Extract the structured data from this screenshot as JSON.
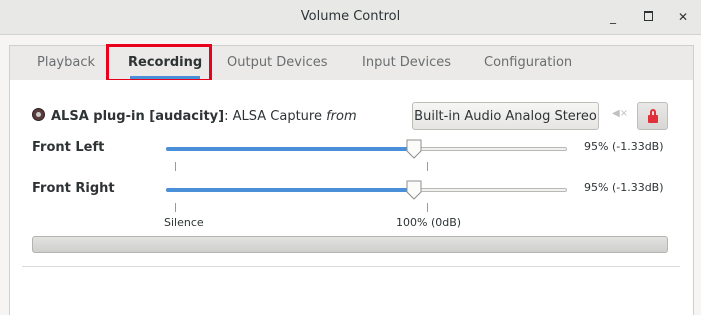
{
  "window": {
    "title": "Volume Control",
    "minimize_label": "_",
    "maximize_label": "◻",
    "close_label": "✕"
  },
  "tabs": [
    {
      "label": "Playback",
      "active": false
    },
    {
      "label": "Recording",
      "active": true
    },
    {
      "label": "Output Devices",
      "active": false
    },
    {
      "label": "Input Devices",
      "active": false
    },
    {
      "label": "Configuration",
      "active": false
    }
  ],
  "stream": {
    "app_icon": "audacity-icon",
    "name": "ALSA plug-in [audacity]",
    "separator": ":",
    "description": "ALSA Capture",
    "from_label": "from",
    "device": "Built-in Audio Analog Stereo",
    "mute_icon": "speaker-muted-icon",
    "lock_icon": "lock-icon",
    "channels": [
      {
        "label": "Front Left",
        "level": 0.95,
        "value_text": "95% (-1.33dB)"
      },
      {
        "label": "Front Right",
        "level": 0.95,
        "value_text": "95% (-1.33dB)"
      }
    ],
    "scale": {
      "silence": "Silence",
      "normal": "100% (0dB)"
    },
    "peak_level": 0
  },
  "colors": {
    "accent": "#4a90d9",
    "highlight_box": "#e8001c",
    "lock": "#e0303a"
  }
}
